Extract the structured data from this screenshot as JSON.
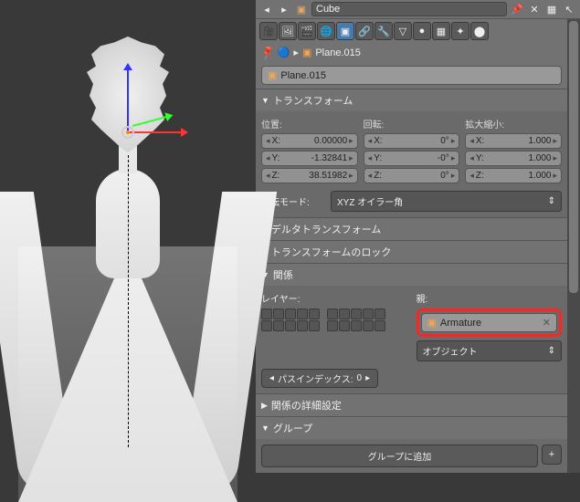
{
  "header": {
    "object_name": "Cube"
  },
  "breadcrumb": {
    "object": "Plane.015"
  },
  "name_field": "Plane.015",
  "sections": {
    "transform": {
      "title": "トランスフォーム",
      "location": {
        "label": "位置:",
        "x": "0.00000",
        "y": "-1.32841",
        "z": "38.51982"
      },
      "rotation": {
        "label": "回転:",
        "x": "0°",
        "y": "-0°",
        "z": "0°"
      },
      "scale": {
        "label": "拡大縮小:",
        "x": "1.000",
        "y": "1.000",
        "z": "1.000"
      },
      "rotation_mode": {
        "label": "回転モード:",
        "value": "XYZ オイラー角"
      }
    },
    "delta_transform": {
      "title": "デルタトランスフォーム"
    },
    "transform_lock": {
      "title": "トランスフォームのロック"
    },
    "relations": {
      "title": "関係",
      "layers_label": "レイヤー:",
      "parent_label": "親:",
      "parent_value": "Armature",
      "parent_type": "オブジェクト",
      "pass_index": {
        "label": "パスインデックス:",
        "value": "0"
      }
    },
    "relations_detail": {
      "title": "関係の詳細設定"
    },
    "group": {
      "title": "グループ",
      "add_button": "グループに追加"
    }
  },
  "axis_labels": {
    "x": "X:",
    "y": "Y:",
    "z": "Z:"
  }
}
